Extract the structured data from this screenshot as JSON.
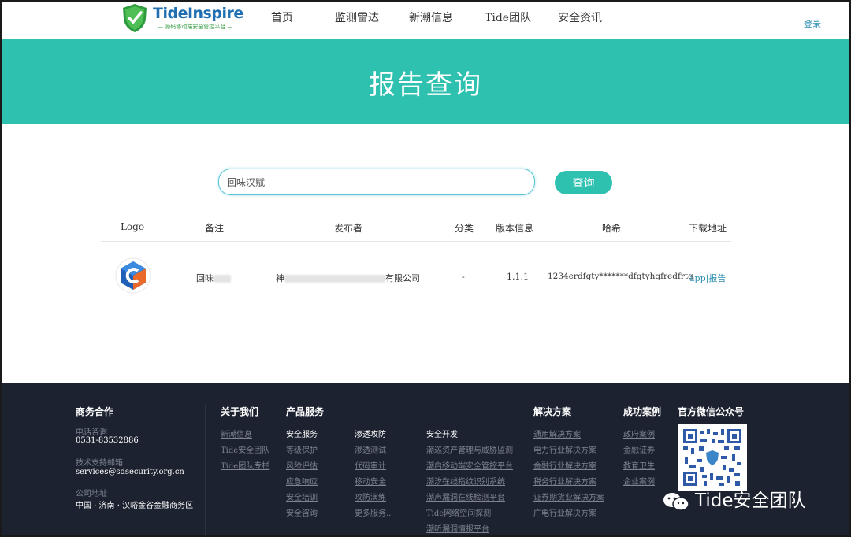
{
  "header": {
    "logo_title": "TideInspire",
    "logo_subtitle": "— 源码移动端安全管控平台 —",
    "nav": [
      "首页",
      "监测雷达",
      "新潮信息",
      "Tide团队",
      "安全资讯"
    ],
    "login": "登录"
  },
  "banner": {
    "title": "报告查询"
  },
  "search": {
    "value": "回味汉赋",
    "button": "查询"
  },
  "table": {
    "headers": [
      "Logo",
      "备注",
      "发布者",
      "分类",
      "版本信息",
      "哈希",
      "下载地址"
    ],
    "row": {
      "note_prefix": "回味",
      "publisher_prefix": "神",
      "publisher_suffix": "有限公司",
      "category": "-",
      "version": "1.1.1",
      "hash": "1234erdfgty*******dfgtyhgfredfrtg",
      "app_link": "app",
      "separator": "|",
      "report_link": "报告"
    }
  },
  "footer": {
    "biz": {
      "title": "商务合作",
      "phone_label": "电话咨询",
      "phone": "0531-83532886",
      "email_label": "技术支持邮箱",
      "email": "services@sdsecurity.org.cn",
      "addr_label": "公司地址",
      "addr": "中国 · 济南 · 汉峪金谷金融商务区"
    },
    "about": {
      "title": "关于我们",
      "items": [
        "新潮信息",
        "Tide安全团队",
        "Tide团队专栏"
      ]
    },
    "products": {
      "title": "产品服务",
      "security": {
        "title": "安全服务",
        "items": [
          "等级保护",
          "风险评估",
          "应急响应",
          "安全培训",
          "安全咨询"
        ]
      },
      "pentest": {
        "title": "渗透攻防",
        "items": [
          "渗透测试",
          "代码审计",
          "移动安全",
          "攻防演练",
          "更多服务.."
        ]
      },
      "dev": {
        "title": "安全开发",
        "items": [
          "潮巡资产管理与威胁监测",
          "潮启移动端安全管控平台",
          "潮汐在线指纹识别系统",
          "潮声漏洞在线检测平台",
          "Tide网络空间探测",
          "潮听漏洞情报平台"
        ]
      }
    },
    "solutions": {
      "title": "解决方案",
      "items": [
        "通用解决方案",
        "电力行业解决方案",
        "金融行业解决方案",
        "税务行业解决方案",
        "证券期货业解决方案",
        "广电行业解决方案"
      ]
    },
    "cases": {
      "title": "成功案例",
      "items": [
        "政府案例",
        "金融证券",
        "教育卫生",
        "企业案例"
      ]
    },
    "wechat": {
      "title": "官方微信公众号"
    },
    "watermark": "Tide安全团队"
  },
  "colors": {
    "teal": "#2ec1b0",
    "footer_bg": "#1d2230",
    "link": "#2e8fb5"
  }
}
